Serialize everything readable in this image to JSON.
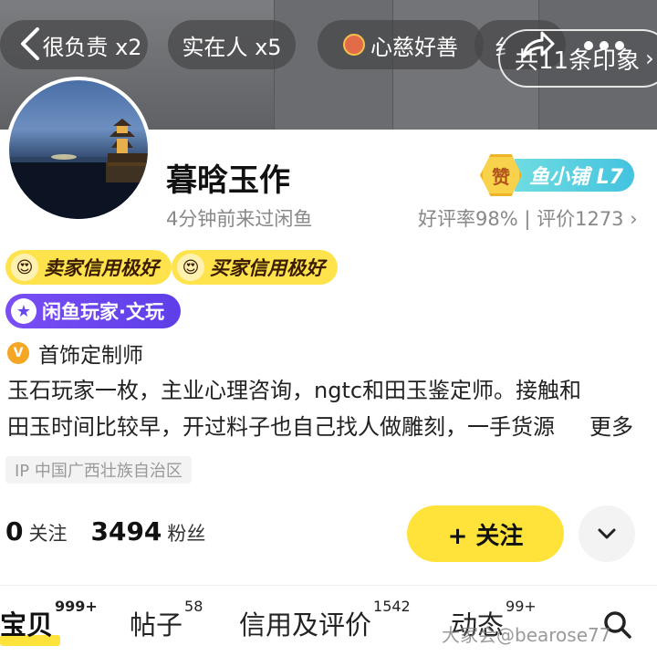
{
  "header": {
    "tags": [
      {
        "label": "很负责 x2"
      },
      {
        "label": "实在人 x5"
      },
      {
        "label": "心慈好善"
      },
      {
        "label": "纟"
      }
    ],
    "impression_label": "共11条印象",
    "impression_chevron": "›"
  },
  "profile": {
    "name": "暮晗玉作",
    "last_seen": "4分钟前来过闲鱼",
    "rating": "好评率98% | 评价1273 ›",
    "shop_badge": {
      "icon_text": "赞",
      "label": "鱼小铺 L7"
    },
    "credit_badges": [
      "卖家信用极好",
      "买家信用极好"
    ],
    "player_badge": "闲鱼玩家·文玩",
    "job_title": "首饰定制师",
    "bio_lines": [
      "玉石玩家一枚，主业心理咨询，ngtc和田玉鉴定师。接触和",
      "田玉时间比较早，开过料子也自己找人做雕刻，一手货源"
    ],
    "bio_more": "更多",
    "ip_location": "IP 中国广西壮族自治区"
  },
  "stats": {
    "following_count": "0",
    "following_label": "关注",
    "fans_count": "3494",
    "fans_label": "粉丝"
  },
  "actions": {
    "follow_label": "+ 关注"
  },
  "tabs": [
    {
      "label": "宝贝",
      "count": "999+"
    },
    {
      "label": "帖子",
      "count": "58"
    },
    {
      "label": "信用及评价",
      "count": "1542"
    },
    {
      "label": "动态",
      "count": "99+"
    }
  ],
  "watermark": "大家会@bearose77",
  "colors": {
    "accent_yellow": "#ffe33b",
    "player_purple": "#6a47ef",
    "shop_teal": "#43c3e0"
  }
}
